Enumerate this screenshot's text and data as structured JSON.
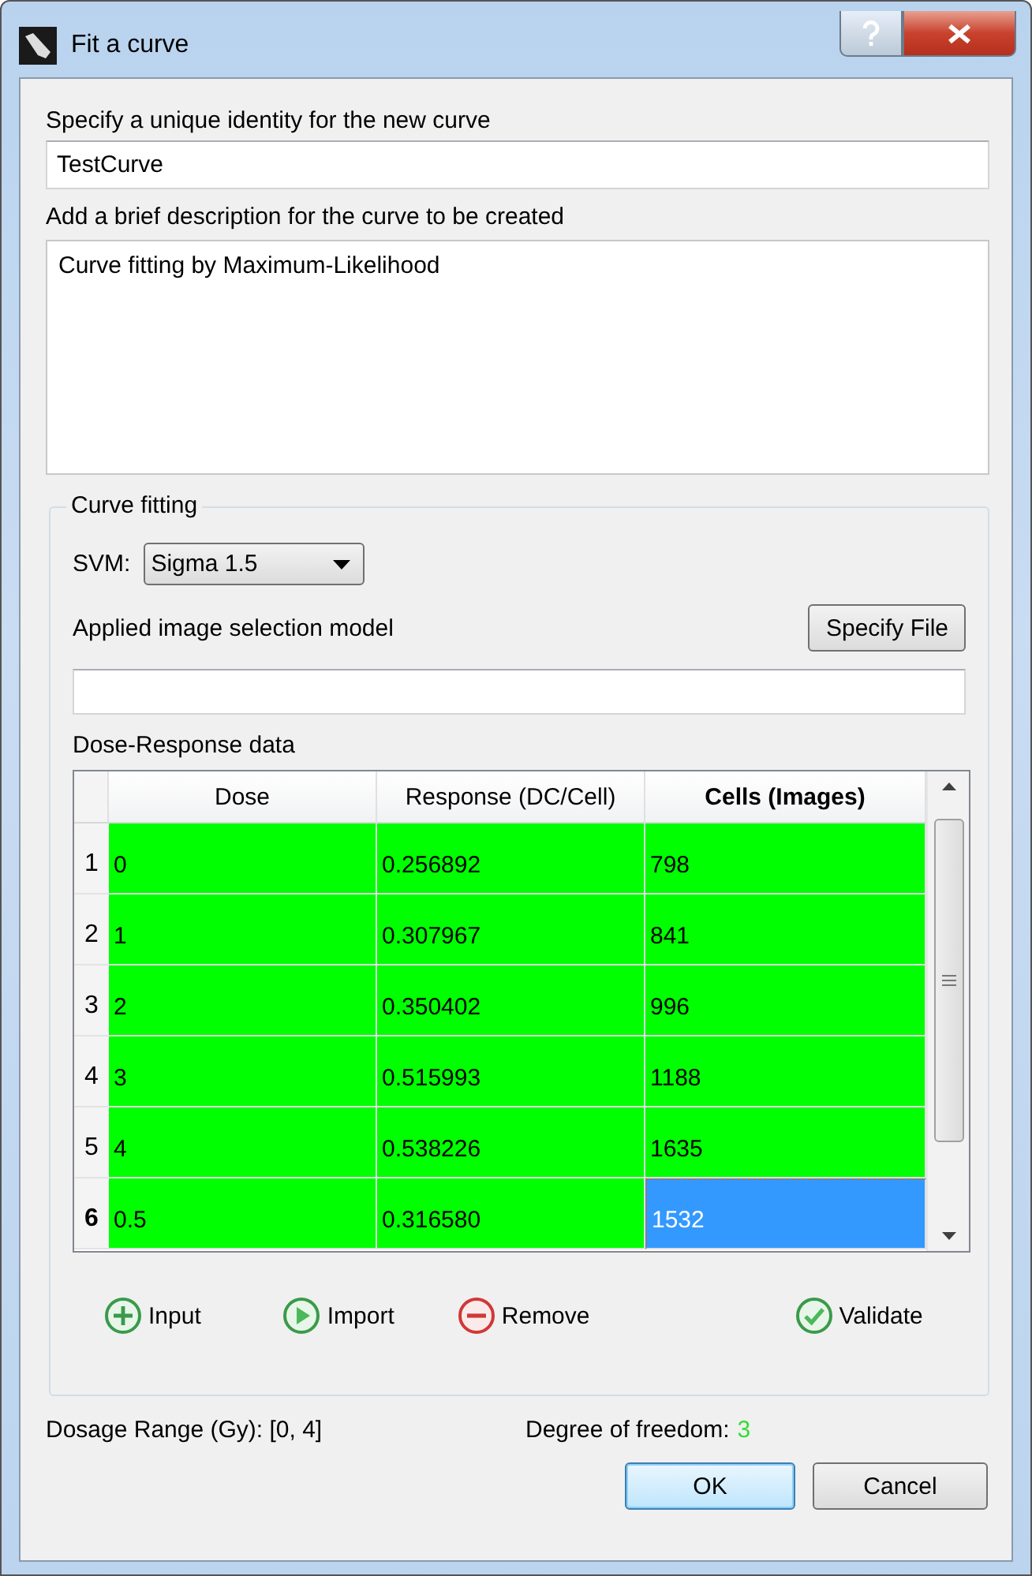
{
  "window": {
    "title": "Fit a curve"
  },
  "identity": {
    "label": "Specify a unique identity for the new curve",
    "value": "TestCurve"
  },
  "description": {
    "label": "Add a brief description for the curve to be created",
    "value": "Curve fitting by Maximum-Likelihood"
  },
  "curve_fitting": {
    "title": "Curve fitting",
    "svm": {
      "label": "SVM:",
      "value": "Sigma 1.5"
    },
    "model": {
      "label": "Applied image selection model",
      "button": "Specify File"
    },
    "table": {
      "label": "Dose-Response data",
      "columns": [
        {
          "label": "Dose",
          "current": false
        },
        {
          "label": "Response (DC/Cell)",
          "current": false
        },
        {
          "label": "Cells (Images)",
          "current": true
        }
      ],
      "rows": [
        {
          "header": "1",
          "current": false,
          "valid": true,
          "cells": [
            {
              "text": "0",
              "selected": false
            },
            {
              "text": "0.256892",
              "selected": false
            },
            {
              "text": "798",
              "selected": false
            }
          ]
        },
        {
          "header": "2",
          "current": false,
          "valid": true,
          "cells": [
            {
              "text": "1",
              "selected": false
            },
            {
              "text": "0.307967",
              "selected": false
            },
            {
              "text": "841",
              "selected": false
            }
          ]
        },
        {
          "header": "3",
          "current": false,
          "valid": true,
          "cells": [
            {
              "text": "2",
              "selected": false
            },
            {
              "text": "0.350402",
              "selected": false
            },
            {
              "text": "996",
              "selected": false
            }
          ]
        },
        {
          "header": "4",
          "current": false,
          "valid": true,
          "cells": [
            {
              "text": "3",
              "selected": false
            },
            {
              "text": "0.515993",
              "selected": false
            },
            {
              "text": "1188",
              "selected": false
            }
          ]
        },
        {
          "header": "5",
          "current": false,
          "valid": true,
          "cells": [
            {
              "text": "4",
              "selected": false
            },
            {
              "text": "0.538226",
              "selected": false
            },
            {
              "text": "1635",
              "selected": false
            }
          ]
        },
        {
          "header": "6",
          "current": true,
          "valid": true,
          "cells": [
            {
              "text": "0.5",
              "selected": false
            },
            {
              "text": "0.316580",
              "selected": false
            },
            {
              "text": "1532",
              "selected": true
            }
          ]
        }
      ]
    },
    "actions": [
      {
        "kind": "add",
        "label": "Input"
      },
      {
        "kind": "import",
        "label": "Import"
      },
      {
        "kind": "remove",
        "label": "Remove"
      },
      {
        "kind": "validate",
        "label": "Validate"
      }
    ]
  },
  "footer": {
    "range_label": "Dosage Range (Gy): [0, 4]",
    "freedom_label": "Degree of freedom:",
    "freedom_value": "3"
  },
  "buttons": [
    {
      "label": "OK",
      "default": true
    },
    {
      "label": "Cancel",
      "default": false
    }
  ]
}
